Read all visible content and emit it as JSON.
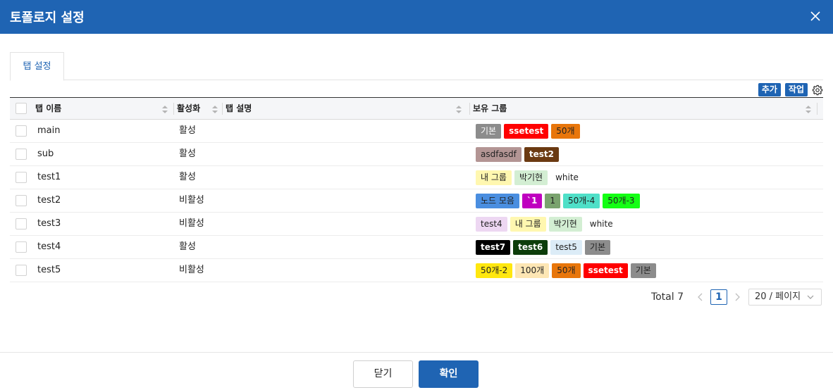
{
  "dialog": {
    "title": "토폴로지 설정"
  },
  "tabs": [
    {
      "label": "탭 설정"
    }
  ],
  "toolbar": {
    "add_label": "추가",
    "action_label": "작업"
  },
  "columns": {
    "name": "탭 이름",
    "active": "활성화",
    "desc": "탭 설명",
    "groups": "보유 그룹"
  },
  "rows": [
    {
      "name": "main",
      "active": "활성",
      "desc": "",
      "groups": [
        {
          "label": "기본",
          "bg": "#8c8c8c",
          "fg": "#ffffff",
          "bold": false
        },
        {
          "label": "ssetest",
          "bg": "#ff0000",
          "fg": "#ffffff",
          "bold": true
        },
        {
          "label": "50개",
          "bg": "#e8760b",
          "fg": "#222222",
          "bold": false
        }
      ]
    },
    {
      "name": "sub",
      "active": "활성",
      "desc": "",
      "groups": [
        {
          "label": "asdfasdf",
          "bg": "#b39594",
          "fg": "#222222",
          "bold": false
        },
        {
          "label": "test2",
          "bg": "#6b3a12",
          "fg": "#ffffff",
          "bold": true
        }
      ]
    },
    {
      "name": "test1",
      "active": "활성",
      "desc": "",
      "groups": [
        {
          "label": "내 그룹",
          "bg": "#fff7b0",
          "fg": "#222222",
          "bold": false
        },
        {
          "label": "박기현",
          "bg": "#d3eed3",
          "fg": "#222222",
          "bold": false
        },
        {
          "label": "white",
          "bg": "#ffffff",
          "fg": "#222222",
          "bold": false
        }
      ]
    },
    {
      "name": "test2",
      "active": "비활성",
      "desc": "",
      "groups": [
        {
          "label": "노드 모음",
          "bg": "#4a8ee0",
          "fg": "#222222",
          "bold": false
        },
        {
          "label": "`1",
          "bg": "#c000c0",
          "fg": "#ffffff",
          "bold": true
        },
        {
          "label": "1",
          "bg": "#7aa36e",
          "fg": "#222222",
          "bold": false
        },
        {
          "label": "50개-4",
          "bg": "#4fe0c8",
          "fg": "#222222",
          "bold": false
        },
        {
          "label": "50개-3",
          "bg": "#14ff14",
          "fg": "#222222",
          "bold": false
        }
      ]
    },
    {
      "name": "test3",
      "active": "비활성",
      "desc": "",
      "groups": [
        {
          "label": "test4",
          "bg": "#edd7f2",
          "fg": "#222222",
          "bold": false
        },
        {
          "label": "내 그룹",
          "bg": "#fff7b0",
          "fg": "#222222",
          "bold": false
        },
        {
          "label": "박기현",
          "bg": "#d3eed3",
          "fg": "#222222",
          "bold": false
        },
        {
          "label": "white",
          "bg": "#ffffff",
          "fg": "#222222",
          "bold": false
        }
      ]
    },
    {
      "name": "test4",
      "active": "활성",
      "desc": "",
      "groups": [
        {
          "label": "test7",
          "bg": "#000000",
          "fg": "#ffffff",
          "bold": true
        },
        {
          "label": "test6",
          "bg": "#0d3d0a",
          "fg": "#ffffff",
          "bold": true
        },
        {
          "label": "test5",
          "bg": "#dcecf7",
          "fg": "#222222",
          "bold": false
        },
        {
          "label": "기본",
          "bg": "#8c8c8c",
          "fg": "#222222",
          "bold": false
        }
      ]
    },
    {
      "name": "test5",
      "active": "비활성",
      "desc": "",
      "groups": [
        {
          "label": "50개-2",
          "bg": "#ffe70f",
          "fg": "#222222",
          "bold": false
        },
        {
          "label": "100개",
          "bg": "#fde6b4",
          "fg": "#222222",
          "bold": false
        },
        {
          "label": "50개",
          "bg": "#e8760b",
          "fg": "#222222",
          "bold": false
        },
        {
          "label": "ssetest",
          "bg": "#ff0000",
          "fg": "#ffffff",
          "bold": true
        },
        {
          "label": "기본",
          "bg": "#8c8c8c",
          "fg": "#222222",
          "bold": false
        }
      ]
    }
  ],
  "pagination": {
    "total_label": "Total 7",
    "current_page": "1",
    "page_size": "20 / 페이지"
  },
  "footer": {
    "close_label": "닫기",
    "confirm_label": "확인"
  },
  "colors": {
    "primary": "#1f64b3",
    "header_bg": "#f5f6f8"
  }
}
